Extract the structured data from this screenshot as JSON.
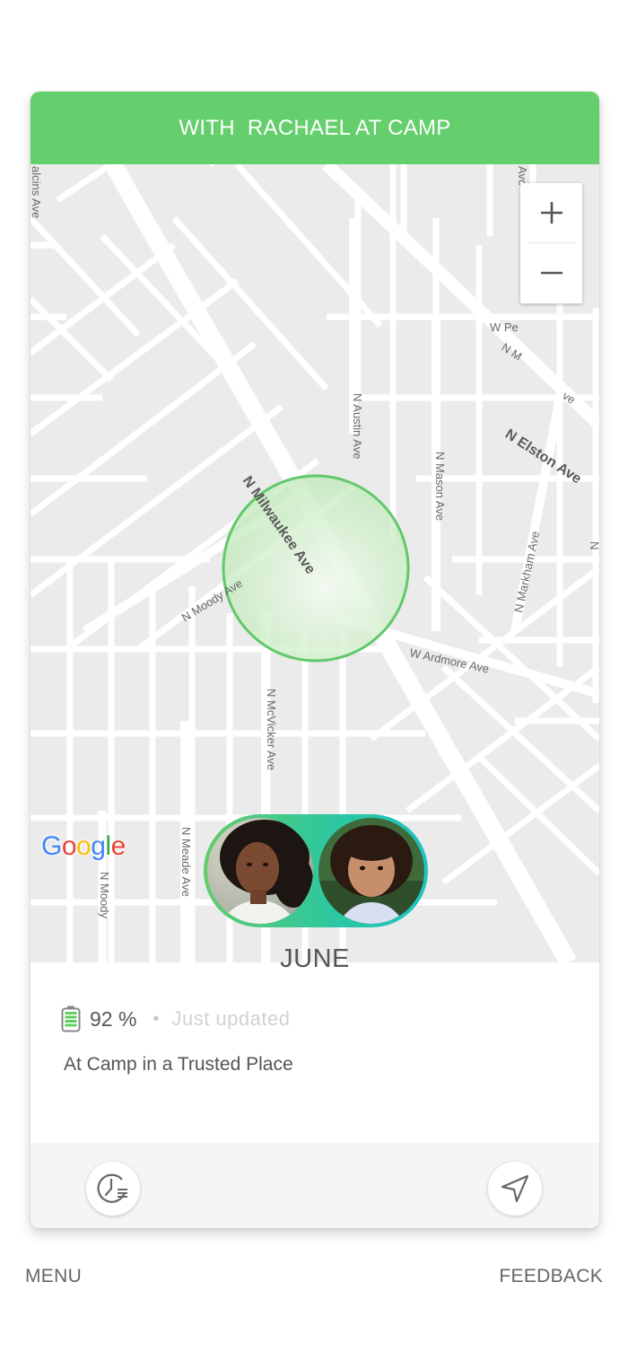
{
  "header": {
    "title": "WITH  RACHAEL AT CAMP"
  },
  "map": {
    "zoom_in_label": "+",
    "zoom_out_label": "−",
    "street_labels": {
      "milwaukee": "N Milwaukee Ave",
      "elston": "N Elston Ave",
      "austin": "N Austin Ave",
      "mason": "N Mason Ave",
      "markham": "N Markham Ave",
      "ardmore": "W Ardmore Ave",
      "moody_diag": "N Moody Ave",
      "mcvicker": "N McVicker Ave",
      "meade": "N Meade Ave",
      "moody_vert": "N Moody",
      "w_pe": "W Pe",
      "n_m_top": "N M",
      "avo": "Avo",
      "ave_right": "ve",
      "edge_left": "alcins Ave",
      "edge_right": "N"
    },
    "attribution": "Google",
    "geofence_color": "#62c96a"
  },
  "person": {
    "name": "JUNE",
    "battery": "92 %",
    "battery_percent": 92,
    "updated": "Just updated",
    "location": "At Camp in a Trusted Place"
  },
  "nav": {
    "menu": "MENU",
    "feedback": "FEEDBACK"
  },
  "icons": {
    "history": "clock-history-icon",
    "navigate": "navigation-arrow-icon",
    "battery": "battery-icon"
  },
  "colors": {
    "accent": "#64cf6c",
    "gradient_end": "#1ec3c4",
    "battery_green": "#5fcf5f"
  }
}
